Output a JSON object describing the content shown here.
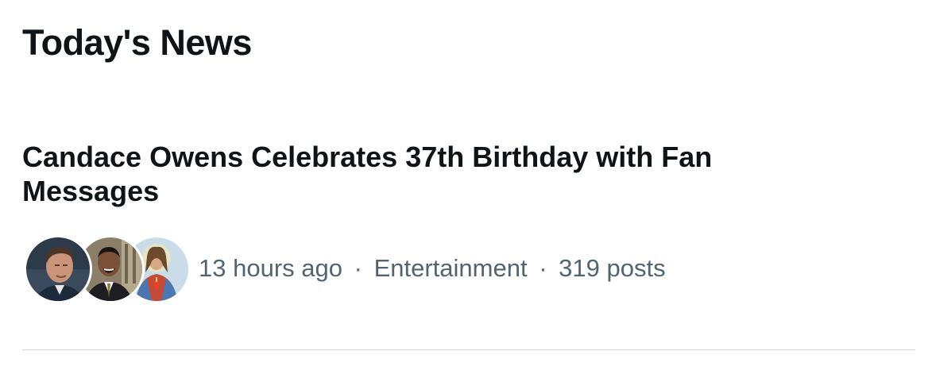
{
  "section": {
    "title": "Today's News"
  },
  "news_item": {
    "headline": "Candace Owens Celebrates 37th Birthday with Fan Messages",
    "time_ago": "13 hours ago",
    "separator": "·",
    "category": "Entertainment",
    "post_count": "319 posts",
    "avatars": [
      "avatar-man-portrait",
      "avatar-man-suit",
      "avatar-sacred-heart-image"
    ]
  },
  "colors": {
    "text_primary": "#0f1419",
    "text_secondary": "#536471",
    "divider": "#cfd9de",
    "background": "#ffffff"
  }
}
